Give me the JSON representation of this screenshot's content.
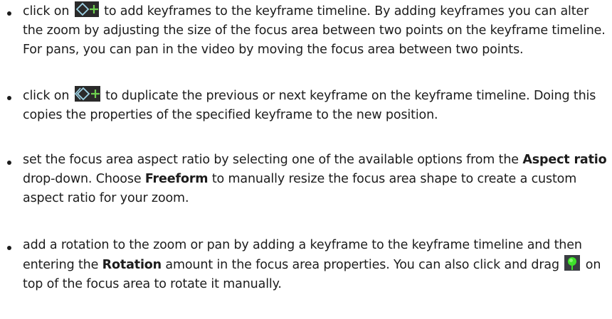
{
  "items": [
    {
      "pre": "click on",
      "icon": "add-keyframe-icon",
      "post": "to add keyframes to the keyframe timeline. By adding keyframes you can alter the zoom by adjusting the size of the focus area between two points on the keyframe timeline. For pans, you can pan in the video by moving the focus area between two points."
    },
    {
      "pre": "click on",
      "icon": "duplicate-keyframe-icon",
      "post": "to duplicate the previous or next keyframe on the keyframe timeline. Doing this copies the properties of the specified keyframe to the new position."
    },
    {
      "t1": "set the focus area aspect ratio by selecting one of the available options from the",
      "b1": "Aspect ratio",
      "t2": "drop-down. Choose",
      "b2": "Freeform",
      "t3": "to manually resize the focus area shape to create a custom aspect ratio for your zoom."
    },
    {
      "t1": "add a rotation to the zoom or pan by adding a keyframe to the keyframe timeline and then entering the",
      "b1": "Rotation",
      "t2": "amount in the focus area properties. You can also click and drag",
      "icon": "rotate-handle-icon",
      "t3": "on top of the focus area to rotate it manually."
    }
  ],
  "colors": {
    "text": "#1c1c1c",
    "icon_bg": "#2a2a2a",
    "icon_stroke": "#9fd3e6",
    "icon_plus": "#6fd14f",
    "rotate_handle": "#3ee22a"
  }
}
